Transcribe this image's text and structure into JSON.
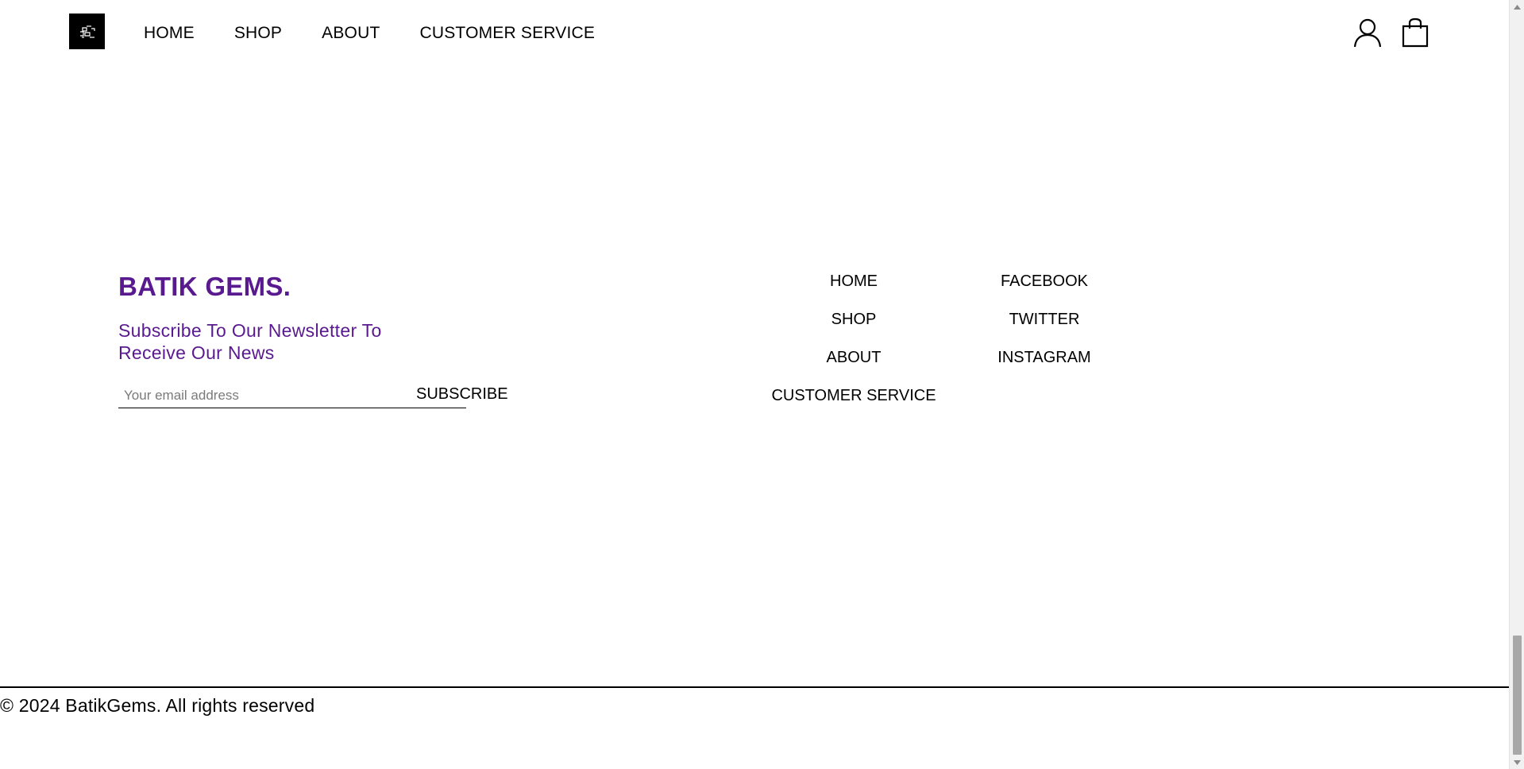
{
  "header": {
    "logo_alt": "BatikGems logo",
    "nav": [
      {
        "label": "HOME"
      },
      {
        "label": "SHOP"
      },
      {
        "label": "ABOUT"
      },
      {
        "label": "CUSTOMER SERVICE"
      }
    ],
    "icons": {
      "account": "user-icon",
      "cart": "shopping-bag-icon"
    }
  },
  "footer": {
    "brand": "BATIK GEMS.",
    "newsletter_text": "Subscribe To Our Newsletter To Receive Our News",
    "email_placeholder": "Your email address",
    "email_value": "",
    "subscribe_label": "SUBSCRIBE",
    "nav_links": [
      {
        "label": "HOME"
      },
      {
        "label": "SHOP"
      },
      {
        "label": "ABOUT"
      },
      {
        "label": "CUSTOMER SERVICE"
      }
    ],
    "social_links": [
      {
        "label": "FACEBOOK"
      },
      {
        "label": "TWITTER"
      },
      {
        "label": "INSTAGRAM"
      }
    ],
    "copyright": "© 2024 BatikGems. All rights reserved"
  },
  "colors": {
    "brand_purple": "#5a1a8f",
    "text": "#000000",
    "background": "#ffffff"
  }
}
